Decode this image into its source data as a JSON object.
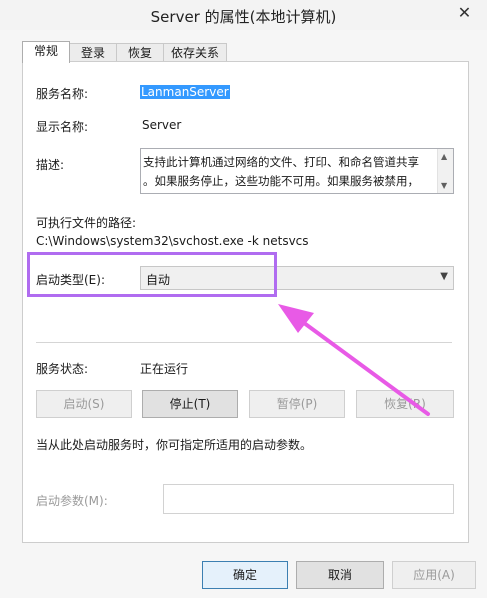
{
  "window": {
    "title": "Server 的属性(本地计算机)",
    "close_glyph": "✕"
  },
  "tabs": [
    {
      "label": "常规"
    },
    {
      "label": "登录"
    },
    {
      "label": "恢复"
    },
    {
      "label": "依存关系"
    }
  ],
  "general": {
    "service_name_label": "服务名称:",
    "service_name_value": "LanmanServer",
    "display_name_label": "显示名称:",
    "display_name_value": "Server",
    "description_label": "描述:",
    "description_line1": "支持此计算机通过网络的文件、打印、和命名管道共享",
    "description_line2": "。如果服务停止，这些功能不可用。如果服务被禁用，",
    "path_label": "可执行文件的路径:",
    "path_value": "C:\\Windows\\system32\\svchost.exe -k netsvcs",
    "startup_type_label": "启动类型(E):",
    "startup_type_value": "自动",
    "service_status_label": "服务状态:",
    "service_status_value": "正在运行",
    "hint": "当从此处启动服务时，你可指定所适用的启动参数。",
    "start_params_label": "启动参数(M):",
    "start_params_value": ""
  },
  "service_buttons": {
    "start": "启动(S)",
    "stop": "停止(T)",
    "pause": "暂停(P)",
    "resume": "恢复(R)"
  },
  "dialog_buttons": {
    "ok": "确定",
    "cancel": "取消",
    "apply": "应用(A)"
  },
  "colors": {
    "annotation": "#b06cf0",
    "arrow": "#e85ae6",
    "selection": "#3399ff"
  }
}
